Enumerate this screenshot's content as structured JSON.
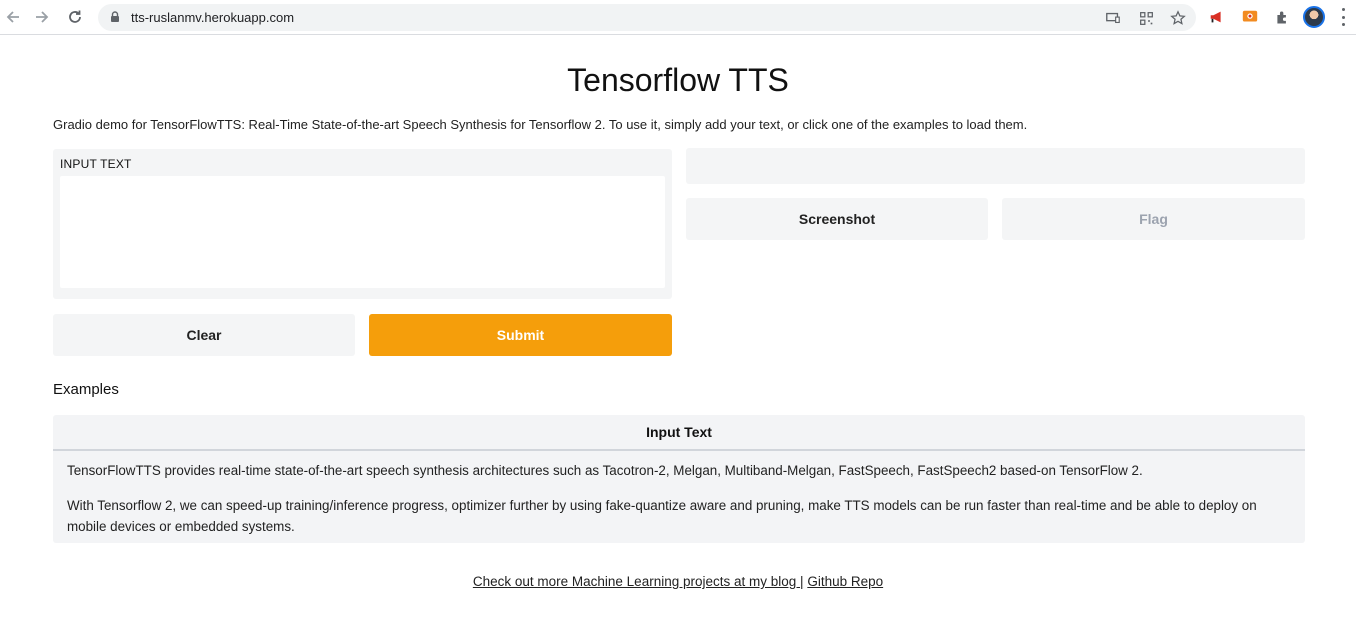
{
  "browser": {
    "url": "tts-ruslanmv.herokuapp.com"
  },
  "page": {
    "title": "Tensorflow TTS",
    "description": "Gradio demo for TensorFlowTTS: Real-Time State-of-the-art Speech Synthesis for Tensorflow 2. To use it, simply add your text, or click one of the examples to load them."
  },
  "input": {
    "label": "INPUT TEXT",
    "value": ""
  },
  "buttons": {
    "clear": "Clear",
    "submit": "Submit",
    "screenshot": "Screenshot",
    "flag": "Flag"
  },
  "examples": {
    "title": "Examples",
    "header": "Input Text",
    "rows": [
      "TensorFlowTTS provides real-time state-of-the-art speech synthesis architectures such as Tacotron-2, Melgan, Multiband-Melgan, FastSpeech, FastSpeech2 based-on TensorFlow 2.",
      "With Tensorflow 2, we can speed-up training/inference progress, optimizer further by using fake-quantize aware and pruning, make TTS models can be run faster than real-time and be able to deploy on mobile devices or embedded systems."
    ]
  },
  "footer": {
    "blog_link": "Check out more Machine Learning projects at my blog ",
    "separator": "|",
    "github_link": "Github Repo"
  },
  "colors": {
    "submit": "#f59e0b",
    "panel": "#f4f5f6"
  }
}
